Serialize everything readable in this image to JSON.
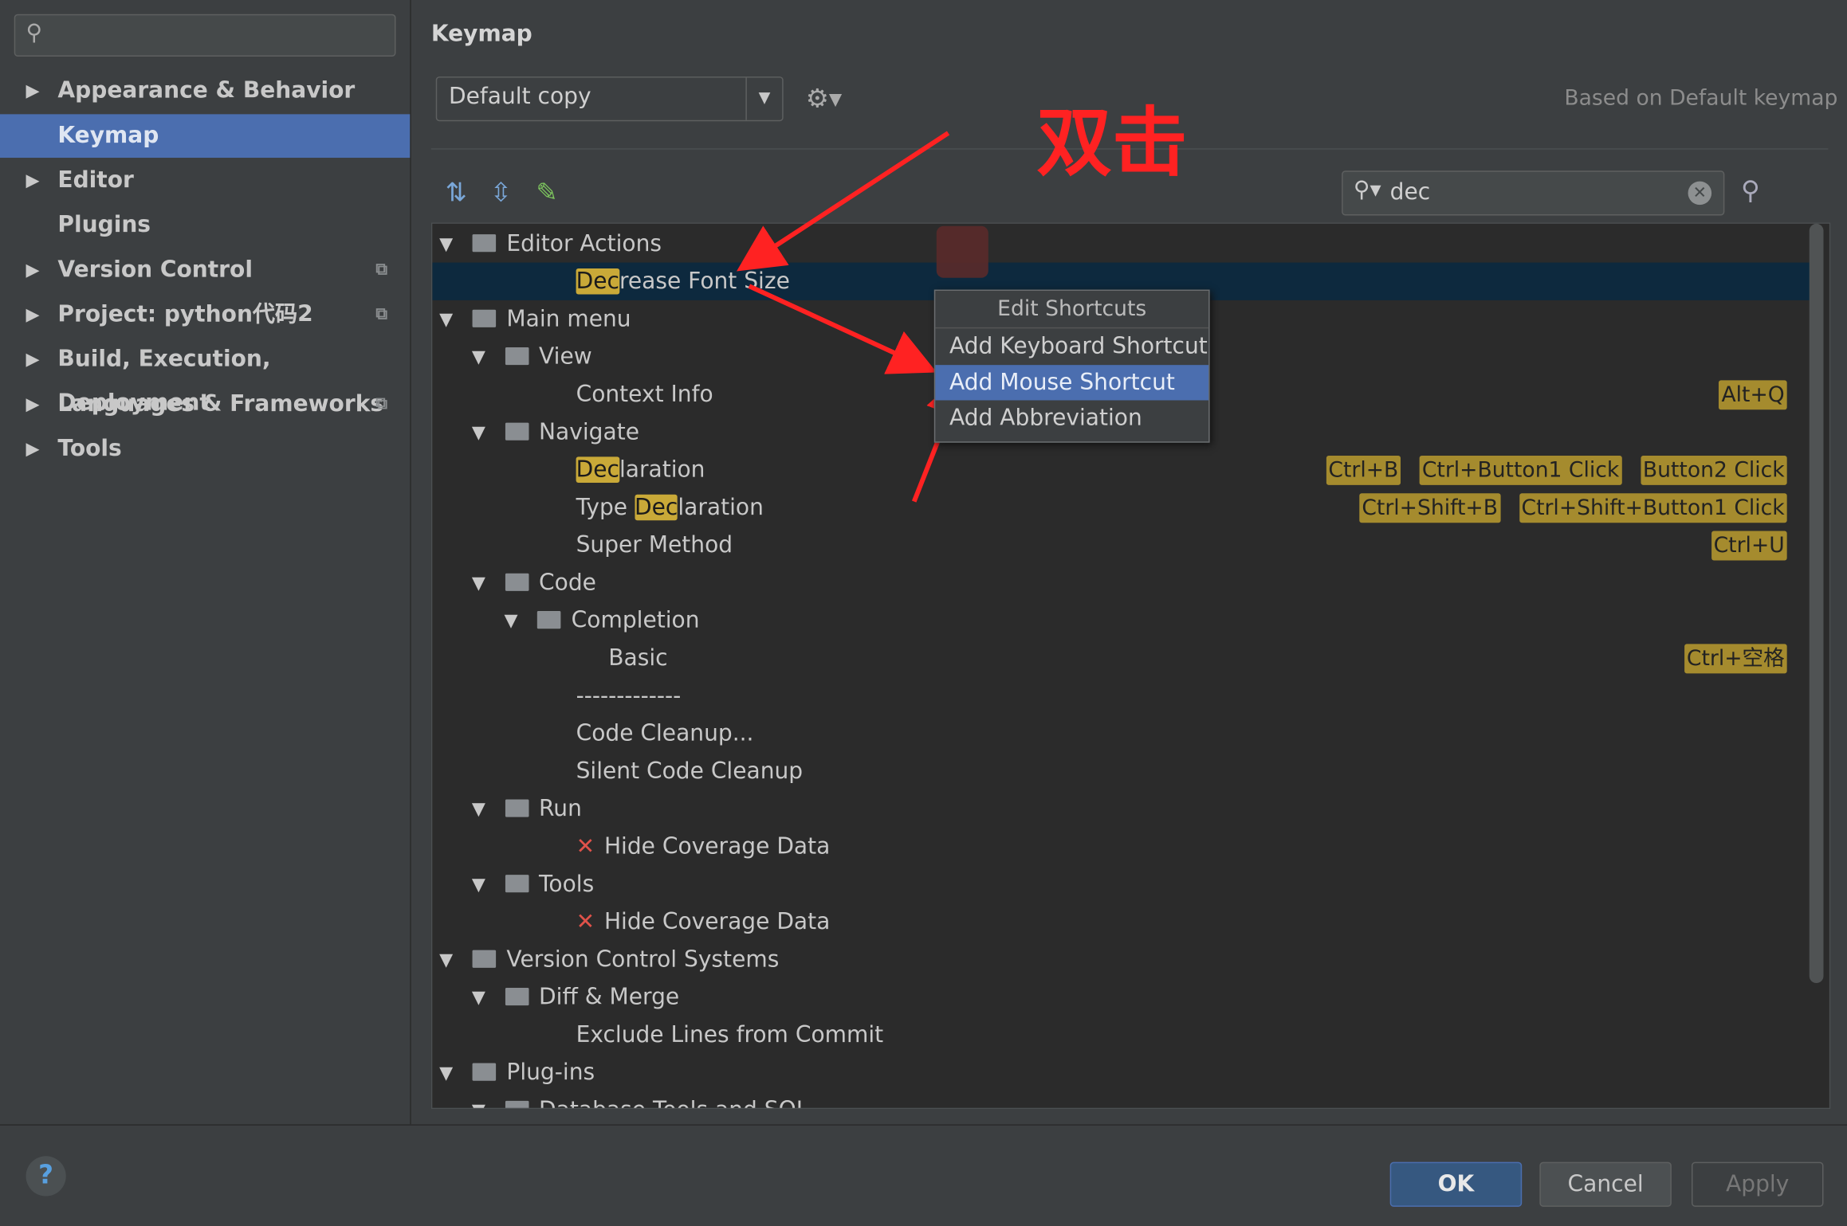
{
  "sidebar": {
    "search_icon": "search-icon",
    "items": [
      {
        "label": "Appearance & Behavior",
        "has_arrow": true,
        "copy": false
      },
      {
        "label": "Keymap",
        "has_arrow": false,
        "copy": false,
        "selected": true
      },
      {
        "label": "Editor",
        "has_arrow": true,
        "copy": false
      },
      {
        "label": "Plugins",
        "has_arrow": false,
        "copy": false
      },
      {
        "label": "Version Control",
        "has_arrow": true,
        "copy": true
      },
      {
        "label": "Project: python代码2",
        "has_arrow": true,
        "copy": true
      },
      {
        "label": "Build, Execution, Deployment",
        "has_arrow": true,
        "copy": false
      },
      {
        "label": "Languages & Frameworks",
        "has_arrow": true,
        "copy": true
      },
      {
        "label": "Tools",
        "has_arrow": true,
        "copy": false
      }
    ]
  },
  "main": {
    "title": "Keymap",
    "keymap_combo": "Default copy",
    "based_on": "Based on Default keymap",
    "search_value": "dec",
    "annotation": "双击"
  },
  "tree": [
    {
      "depth": 0,
      "open": true,
      "icon": "editor-actions-icon",
      "label": "Editor Actions"
    },
    {
      "depth": 2,
      "leaf": true,
      "hl_pre": "",
      "hl": "Dec",
      "hl_post": "rease Font Size",
      "selected": true
    },
    {
      "depth": 0,
      "open": true,
      "icon": "main-menu-icon",
      "label": "Main menu"
    },
    {
      "depth": 1,
      "open": true,
      "icon": "folder-icon",
      "label": "View"
    },
    {
      "depth": 2,
      "leaf": true,
      "label": "Context Info",
      "shortcuts": [
        "Alt+Q"
      ]
    },
    {
      "depth": 1,
      "open": true,
      "icon": "folder-icon",
      "label": "Navigate"
    },
    {
      "depth": 2,
      "leaf": true,
      "hl_pre": "",
      "hl": "Dec",
      "hl_post": "laration",
      "shortcuts": [
        "Ctrl+B",
        "Ctrl+Button1 Click",
        "Button2 Click"
      ]
    },
    {
      "depth": 2,
      "leaf": true,
      "hl_pre": "Type ",
      "hl": "Dec",
      "hl_post": "laration",
      "shortcuts": [
        "Ctrl+Shift+B",
        "Ctrl+Shift+Button1 Click"
      ]
    },
    {
      "depth": 2,
      "leaf": true,
      "label": "Super Method",
      "shortcuts": [
        "Ctrl+U"
      ]
    },
    {
      "depth": 1,
      "open": true,
      "icon": "folder-icon",
      "label": "Code"
    },
    {
      "depth": 2,
      "open": true,
      "icon": "folder-icon",
      "label": "Completion"
    },
    {
      "depth": 3,
      "leaf": true,
      "label": "Basic",
      "shortcuts": [
        "Ctrl+空格"
      ]
    },
    {
      "depth": 2,
      "leaf": true,
      "label": "-------------"
    },
    {
      "depth": 2,
      "leaf": true,
      "label": "Code Cleanup..."
    },
    {
      "depth": 2,
      "leaf": true,
      "label": "Silent Code Cleanup"
    },
    {
      "depth": 1,
      "open": true,
      "icon": "folder-icon",
      "label": "Run"
    },
    {
      "depth": 2,
      "leaf": true,
      "x": true,
      "label": "Hide Coverage Data"
    },
    {
      "depth": 1,
      "open": true,
      "icon": "folder-icon",
      "label": "Tools"
    },
    {
      "depth": 2,
      "leaf": true,
      "x": true,
      "label": "Hide Coverage Data"
    },
    {
      "depth": 0,
      "open": true,
      "icon": "folder-icon",
      "label": "Version Control Systems"
    },
    {
      "depth": 1,
      "open": true,
      "icon": "folder-icon",
      "label": "Diff & Merge"
    },
    {
      "depth": 2,
      "leaf": true,
      "label": "Exclude Lines from Commit"
    },
    {
      "depth": 0,
      "open": true,
      "icon": "folder-icon",
      "label": "Plug-ins"
    },
    {
      "depth": 1,
      "open": true,
      "icon": "folder-icon",
      "label": "Database Tools and SQL"
    }
  ],
  "popup": {
    "header": "Edit Shortcuts",
    "items": [
      "Add Keyboard Shortcut",
      "Add Mouse Shortcut",
      "Add Abbreviation"
    ],
    "selected": 1
  },
  "buttons": {
    "ok": "OK",
    "cancel": "Cancel",
    "apply": "Apply",
    "help": "?"
  },
  "colors": {
    "accent": "#4b6eaf",
    "highlight": "#c9a938",
    "annotation": "#ff2222"
  }
}
